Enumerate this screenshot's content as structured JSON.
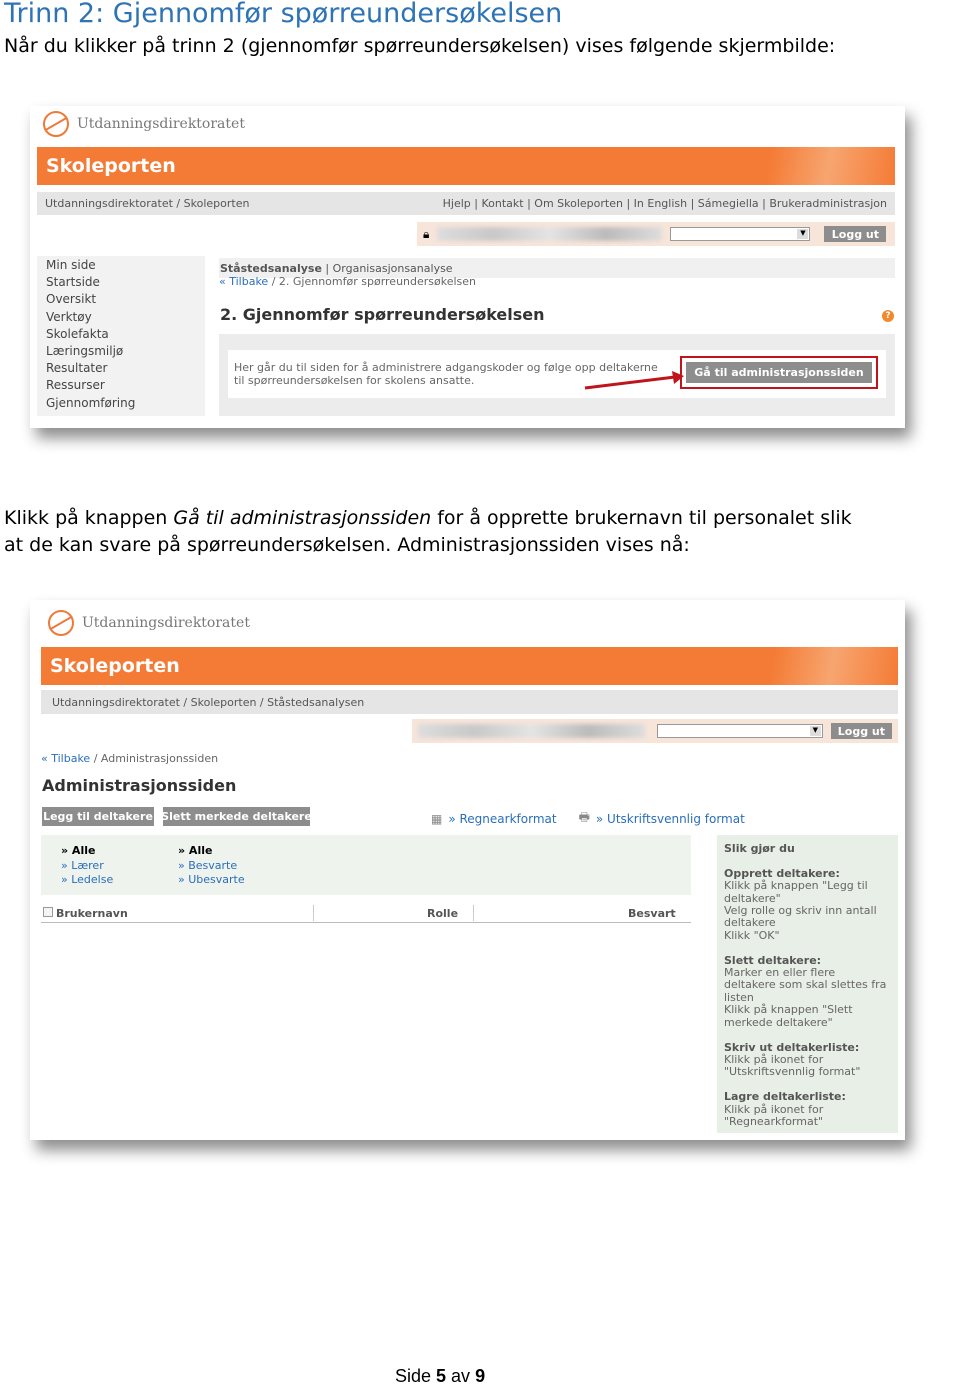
{
  "heading": "Trinn 2: Gjennomfør spørreundersøkelsen",
  "intro": "Når du klikker på trinn 2 (gjennomfør spørreundersøkelsen) vises følgende skjermbilde:",
  "para2": {
    "a": "Klikk på knappen ",
    "em": "Gå til administrasjonssiden",
    "b": " for å opprette brukernavn til personalet slik",
    "line2": "at de kan svare på spørreundersøkelsen. Administrasjonssiden vises nå:"
  },
  "footer": {
    "prefix": "Side ",
    "page": "5",
    "mid": " av ",
    "total": "9"
  },
  "colors": {
    "orange": "#f47b35",
    "link": "#2a6ebb",
    "heading": "#2e74b5",
    "arrow": "#c0141c"
  },
  "shot1": {
    "logo": "Utdanningsdirektoratet",
    "banner": "Skoleporten",
    "breadcrumb": "Utdanningsdirektoratet / Skoleporten",
    "toplinks": "Hjelp | Kontakt | Om Skoleporten | In English | Sámegiella | Brukeradministrasjon",
    "logout": "Logg ut",
    "menu": [
      "Min side",
      "Startside",
      "Oversikt",
      "Verktøy",
      "Skolefakta",
      "Læringsmiljø",
      "Resultater",
      "Ressurser",
      "Gjennomføring"
    ],
    "tab_active": "Ståstedsanalyse",
    "tab_other": "Organisasjonsanalyse",
    "back": "« Tilbake",
    "crumb": " / 2. Gjennomfør spørreundersøkelsen",
    "title": "2. Gjennomfør spørreundersøkelsen",
    "help": "?",
    "text1": "Her går du til siden for å administrere adgangskoder og følge opp deltakerne",
    "text2": "til spørreundersøkelsen for skolens ansatte.",
    "button": "Gå til administrasjonssiden"
  },
  "shot2": {
    "logo": "Utdanningsdirektoratet",
    "banner": "Skoleporten",
    "breadcrumb": "Utdanningsdirektoratet / Skoleporten / Ståstedsanalysen",
    "logout": "Logg ut",
    "back": "« Tilbake",
    "crumb": "/ Administrasjonssiden",
    "title": "Administrasjonssiden",
    "add_btn": "Legg til deltakere",
    "del_btn": "Slett merkede deltakere",
    "spreadsheet": "» Regnearkformat",
    "print": "» Utskriftsvennlig format",
    "filter1": [
      "» Alle",
      "» Lærer",
      "» Ledelse"
    ],
    "filter2": [
      "» Alle",
      "» Besvarte",
      "» Ubesvarte"
    ],
    "columns": [
      "Brukernavn",
      "Rolle",
      "Besvart"
    ],
    "help": {
      "title": "Slik gjør du",
      "s1h": "Opprett deltakere:",
      "s1": [
        "Klikk på knappen \"Legg til",
        "deltakere\"",
        "Velg rolle og skriv inn antall",
        "deltakere",
        "Klikk \"OK\""
      ],
      "s2h": "Slett deltakere:",
      "s2": [
        "Marker en eller flere",
        "deltakere som skal slettes fra",
        "listen",
        "Klikk på knappen \"Slett",
        "merkede deltakere\""
      ],
      "s3h": "Skriv ut deltakerliste:",
      "s3": [
        "Klikk på ikonet for",
        "\"Utskriftsvennlig format\""
      ],
      "s4h": "Lagre deltakerliste:",
      "s4": [
        "Klikk på ikonet for",
        "\"Regnearkformat\""
      ]
    }
  }
}
